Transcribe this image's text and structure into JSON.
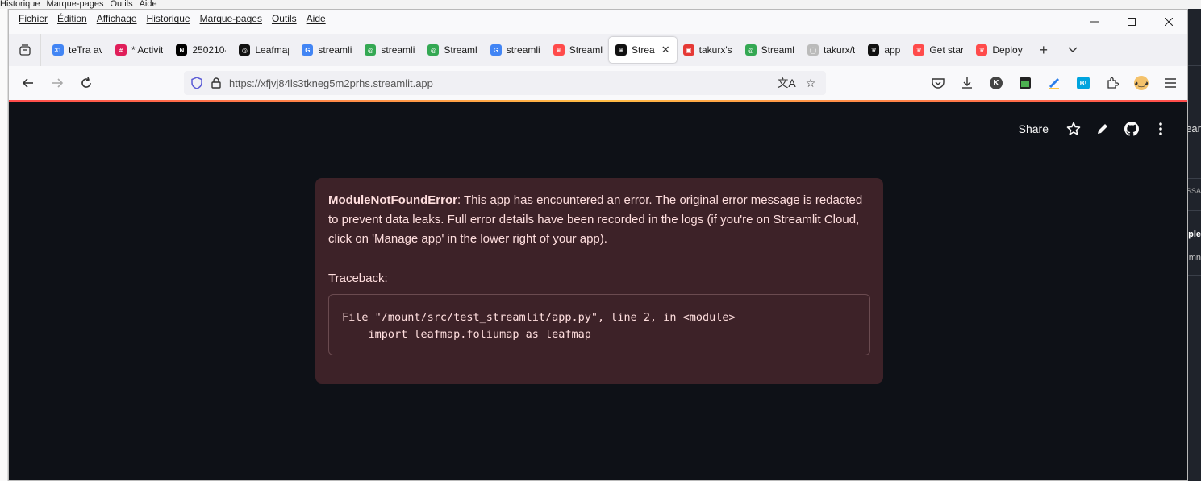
{
  "background": {
    "menu": [
      "Historique",
      "Marque-pages",
      "Outils",
      "Aide"
    ],
    "right_fragments": [
      "ear",
      "ISSA",
      "ple",
      "mn"
    ]
  },
  "menu": [
    "Fichier",
    "Édition",
    "Affichage",
    "Historique",
    "Marque-pages",
    "Outils",
    "Aide"
  ],
  "tabs": [
    {
      "label": "teTra av",
      "fav": "31",
      "color": "#4285f4"
    },
    {
      "label": "* Activit",
      "fav": "#",
      "color": "#e01e5a"
    },
    {
      "label": "250210-",
      "fav": "N",
      "color": "#000000"
    },
    {
      "label": "Leafmap",
      "fav": "◎",
      "color": "#111111"
    },
    {
      "label": "streamli",
      "fav": "G",
      "color": "#4285f4"
    },
    {
      "label": "streamli",
      "fav": "◎",
      "color": "#34a853"
    },
    {
      "label": "Streaml",
      "fav": "◎",
      "color": "#34a853"
    },
    {
      "label": "streamli",
      "fav": "G",
      "color": "#4285f4"
    },
    {
      "label": "Streaml",
      "fav": "♛",
      "color": "#ff4b4b"
    },
    {
      "label": "Strea",
      "fav": "♛",
      "color": "#111111",
      "active": true
    },
    {
      "label": "takurx's",
      "fav": "▣",
      "color": "#e53935"
    },
    {
      "label": "Streaml",
      "fav": "◎",
      "color": "#34a853"
    },
    {
      "label": "takurx/t",
      "fav": "◯",
      "color": "#bbbbbb"
    },
    {
      "label": "app",
      "fav": "♛",
      "color": "#111111"
    },
    {
      "label": "Get star",
      "fav": "♛",
      "color": "#ff4b4b"
    },
    {
      "label": "Deploy",
      "fav": "♛",
      "color": "#ff4b4b"
    }
  ],
  "url": "https://xfjvj84ls3tkneg5m2prhs.streamlit.app",
  "app": {
    "share_label": "Share",
    "error_type": "ModuleNotFoundError",
    "error_message": ": This app has encountered an error. The original error message is redacted to prevent data leaks. Full error details have been recorded in the logs (if you're on Streamlit Cloud, click on 'Manage app' in the lower right of your app).",
    "traceback_label": "Traceback:",
    "traceback_code": "File \"/mount/src/test_streamlit/app.py\", line 2, in <module>\n    import leafmap.foliumap as leafmap"
  },
  "colors": {
    "app_bg": "#0e1117",
    "error_bg": "#3d2228",
    "error_text": "#ffdede",
    "accent": "#ff4b4b"
  }
}
